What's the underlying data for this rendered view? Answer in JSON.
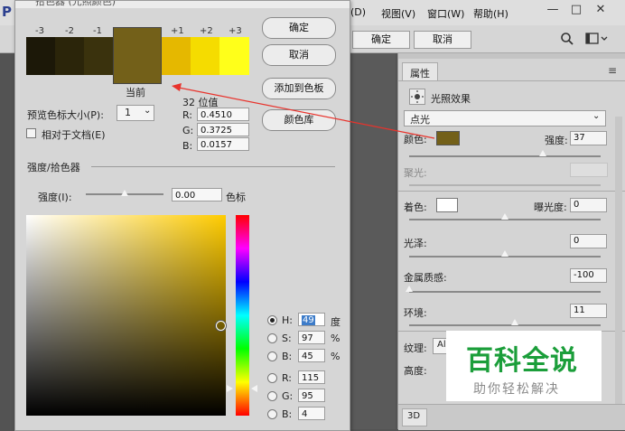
{
  "menubar": {
    "logo": "P",
    "items": [
      "(D)",
      "视图(V)",
      "窗口(W)",
      "帮助(H)"
    ],
    "window_controls": {
      "minimize": "—",
      "restore": "□",
      "close": "✕"
    }
  },
  "options_bar": {
    "ok_label": "确定",
    "cancel_label": "取消"
  },
  "properties_panel": {
    "tab_title": "属性",
    "effect_title": "光照效果",
    "light_type": "点光",
    "color_label": "颜色:",
    "color_value": "#736019",
    "intensity_label": "强度:",
    "intensity_value": "37",
    "intensity_level": 0.7,
    "hotspot_label": "聚光:",
    "tint_label": "着色:",
    "tint_color": "#ffffff",
    "exposure_label": "曝光度:",
    "exposure_value": "0",
    "exposure_level": 0.5,
    "gloss_label": "光泽:",
    "gloss_value": "0",
    "gloss_level": 0.5,
    "metallic_label": "金属质感:",
    "metallic_value": "-100",
    "metallic_level": 0.0,
    "ambience_label": "环境:",
    "ambience_value": "11",
    "ambience_level": 0.55,
    "texture_label": "纹理:",
    "texture_value": "Al",
    "height_label": "高度:",
    "footer_tab": "3D"
  },
  "color_picker": {
    "title": "拾色器 (光照颜色)",
    "swatch_labels": [
      "-3",
      "-2",
      "-1",
      "+1",
      "+2",
      "+3"
    ],
    "swatch_colors": [
      "#1c1808",
      "#2b250a",
      "#3a320d",
      "#e5b800",
      "#f5dc00",
      "#ffff1a"
    ],
    "current_color": "#736019",
    "current_label": "当前",
    "bits_label": "32 位值",
    "r32_label": "R:",
    "r32_value": "0.4510",
    "g32_label": "G:",
    "g32_value": "0.3725",
    "b32_label": "B:",
    "b32_value": "0.0157",
    "swatch_size_label": "预览色标大小(P):",
    "swatch_size_value": "1",
    "relative_label": "相对于文档(E)",
    "intensity_section_label": "强度/拾色器",
    "intensity_label": "强度(I):",
    "intensity_value": "0.00",
    "intensity_unit": "色标",
    "buttons": {
      "ok": "确定",
      "cancel": "取消",
      "add_swatch": "添加到色板",
      "color_library": "颜色库"
    },
    "hsb": {
      "h_label": "H:",
      "h_value": "49",
      "h_unit": "度",
      "s_label": "S:",
      "s_value": "97",
      "s_unit": "%",
      "b_label": "B:",
      "b_value": "45",
      "b_unit": "%"
    },
    "rgb": {
      "r_label": "R:",
      "r_value": "115",
      "g_label": "G:",
      "g_value": "95",
      "b_label": "B:",
      "b_value": "4"
    },
    "field_hue_color": "#ffcc00"
  },
  "watermark": {
    "title": "百科全说",
    "subtitle": "助你轻松解决"
  },
  "colors": {
    "dialog_bg": "#d6d6d6",
    "arrow": "#e8332c",
    "watermark_green": "#1b9e3a"
  }
}
